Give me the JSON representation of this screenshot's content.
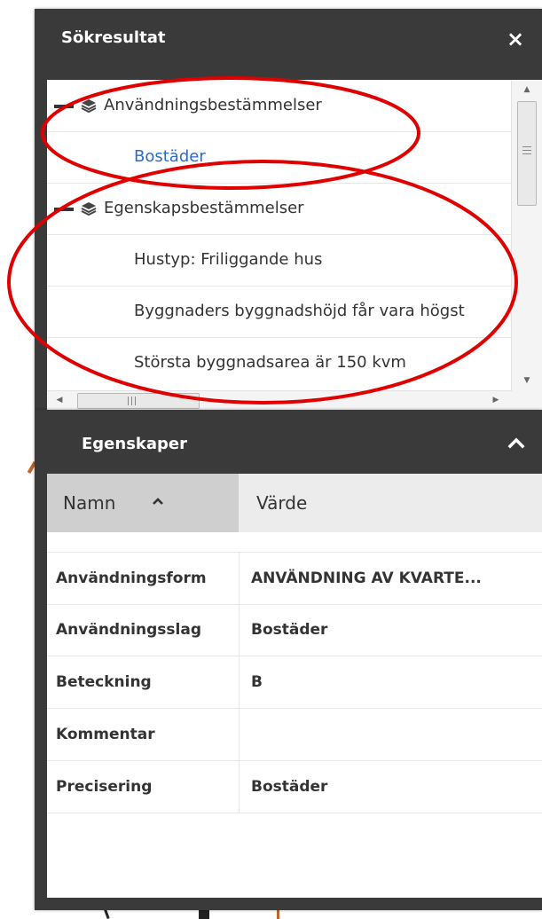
{
  "search_panel": {
    "title": "Sökresultat",
    "close_label": "×",
    "tree": [
      {
        "type": "group",
        "label": "Användningsbestämmelser"
      },
      {
        "type": "item",
        "label": "Bostäder",
        "link": true
      },
      {
        "type": "group",
        "label": "Egenskapsbestämmelser"
      },
      {
        "type": "item",
        "label": "Hustyp: Friliggande hus"
      },
      {
        "type": "item",
        "label": "Byggnaders byggnadshöjd får vara högst"
      },
      {
        "type": "item",
        "label": "Största byggnadsarea är 150 kvm"
      }
    ],
    "hscroll_grip": "III"
  },
  "props_panel": {
    "title": "Egenskaper",
    "columns": {
      "name": "Namn",
      "value": "Värde"
    },
    "rows": [
      {
        "name": "Användningsform",
        "value": "ANVÄNDNING AV KVARTE..."
      },
      {
        "name": "Användningsslag",
        "value": "Bostäder"
      },
      {
        "name": "Beteckning",
        "value": "B"
      },
      {
        "name": "Kommentar",
        "value": ""
      },
      {
        "name": "Precisering",
        "value": "Bostäder"
      }
    ]
  },
  "colors": {
    "panel_header": "#3a3a3a",
    "link": "#2b6cc4",
    "annotation": "#e00000"
  },
  "icons": [
    "close-icon",
    "layers-icon",
    "chevron-up-icon",
    "sort-up-icon"
  ]
}
